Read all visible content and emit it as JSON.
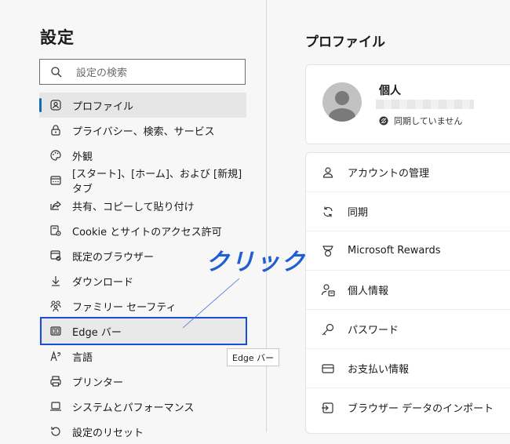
{
  "sidebar": {
    "title": "設定",
    "search": {
      "placeholder": "設定の検索"
    },
    "items": [
      {
        "label": "プロファイル",
        "icon": "profile-icon",
        "active": true
      },
      {
        "label": "プライバシー、検索、サービス",
        "icon": "lock-icon"
      },
      {
        "label": "外観",
        "icon": "palette-icon"
      },
      {
        "label": "[スタート]、[ホーム]、および [新規] タブ",
        "icon": "start-tab-icon"
      },
      {
        "label": "共有、コピーして貼り付け",
        "icon": "share-icon"
      },
      {
        "label": "Cookie とサイトのアクセス許可",
        "icon": "site-permissions-icon"
      },
      {
        "label": "既定のブラウザー",
        "icon": "default-browser-icon"
      },
      {
        "label": "ダウンロード",
        "icon": "download-icon"
      },
      {
        "label": "ファミリー セーフティ",
        "icon": "family-icon"
      },
      {
        "label": "Edge バー",
        "icon": "edge-bar-icon",
        "hovered": true
      },
      {
        "label": "言語",
        "icon": "language-icon"
      },
      {
        "label": "プリンター",
        "icon": "printer-icon"
      },
      {
        "label": "システムとパフォーマンス",
        "icon": "laptop-icon"
      },
      {
        "label": "設定のリセット",
        "icon": "reset-icon"
      }
    ]
  },
  "tooltip": {
    "text": "Edge バー"
  },
  "annotation": {
    "text": "クリック",
    "color": "#1f5fd1"
  },
  "main": {
    "title": "プロファイル",
    "profile": {
      "name": "個人",
      "sync_status": "同期していません"
    },
    "menu": [
      {
        "label": "アカウントの管理",
        "icon": "person-icon"
      },
      {
        "label": "同期",
        "icon": "sync-icon"
      },
      {
        "label": "Microsoft Rewards",
        "icon": "trophy-icon"
      },
      {
        "label": "個人情報",
        "icon": "person-info-icon"
      },
      {
        "label": "パスワード",
        "icon": "key-icon"
      },
      {
        "label": "お支払い情報",
        "icon": "credit-card-icon"
      },
      {
        "label": "ブラウザー データのインポート",
        "icon": "import-icon"
      }
    ]
  },
  "colors": {
    "accent": "#0f6cbd",
    "highlight": "#1a4ed8"
  }
}
